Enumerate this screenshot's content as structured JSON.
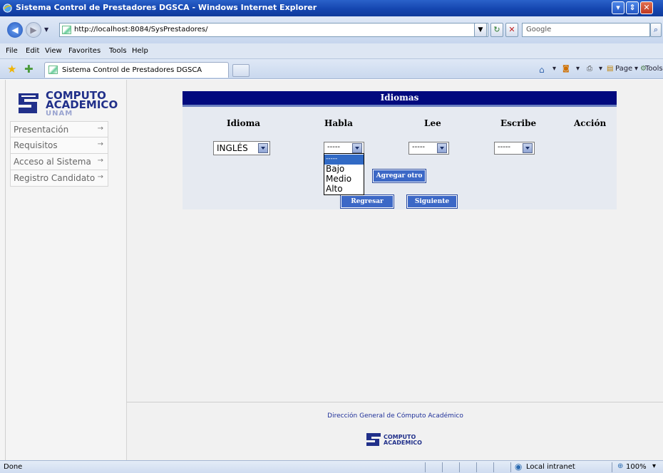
{
  "window": {
    "title": "Sistema Control de Prestadores DGSCA - Windows Internet Explorer",
    "buttons": [
      "minimize",
      "maximize",
      "close"
    ]
  },
  "address_bar": {
    "url": "http://localhost:8084/SysPrestadores/",
    "search_placeholder": "Google"
  },
  "menu_bar": [
    "File",
    "Edit",
    "View",
    "Favorites",
    "Tools",
    "Help"
  ],
  "tab": {
    "title": "Sistema Control de Prestadores DGSCA"
  },
  "command_bar": {
    "page_label": "Page",
    "tools_label": "Tools"
  },
  "sidebar": {
    "logo": {
      "line1": "COMPUTO",
      "line2": "ACADEMICO",
      "line3": "UNAM"
    },
    "items": [
      {
        "label": "Presentación",
        "arrow": "→"
      },
      {
        "label": "Requisitos",
        "arrow": "→"
      },
      {
        "label": "Acceso al Sistema",
        "arrow": "→"
      },
      {
        "label": "Registro Candidato",
        "arrow": "→"
      }
    ]
  },
  "form": {
    "title": "Idiomas",
    "columns": [
      "Idioma",
      "Habla",
      "Lee",
      "Escribe",
      "Acción"
    ],
    "idioma": {
      "value": "INGLÉS"
    },
    "habla": {
      "value": "-----"
    },
    "lee": {
      "value": "-----"
    },
    "escribe": {
      "value": "-----"
    },
    "habla_options": [
      "-----",
      "Bajo",
      "Medio",
      "Alto"
    ],
    "habla_selected_index": 0,
    "add_button": "Agregar otro",
    "back_button": "Regresar",
    "next_button": "Siguiente"
  },
  "footer": {
    "text": "Dirección General de Cómputo Académico"
  },
  "status_bar": {
    "status": "Done",
    "zone": "Local intranet",
    "zoom": "100%"
  },
  "colors": {
    "panel_header": "#020a7e",
    "button": "#3c68c6",
    "logo_blue": "#21308a"
  }
}
